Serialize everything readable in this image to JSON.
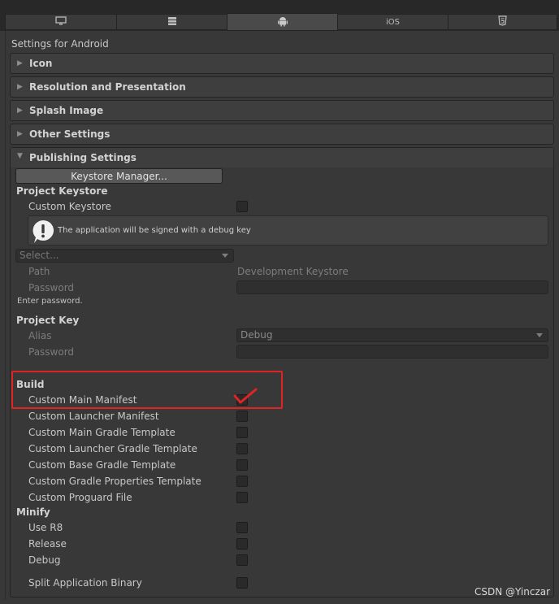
{
  "tabs": [
    {
      "icon": "monitor-icon"
    },
    {
      "icon": "server-icon"
    },
    {
      "icon": "android-icon",
      "active": true
    },
    {
      "label": "iOS"
    },
    {
      "icon": "html5-icon"
    }
  ],
  "header": "Settings for Android",
  "sections": {
    "icon": "Icon",
    "resolution": "Resolution and Presentation",
    "splash": "Splash Image",
    "other": "Other Settings",
    "publishing": "Publishing Settings"
  },
  "keystore_manager_button": "Keystore Manager...",
  "project_keystore": {
    "heading": "Project Keystore",
    "custom_keystore": "Custom Keystore",
    "info_message": "The application will be signed with a debug key",
    "select_value": "Select...",
    "path_label": "Path",
    "path_value": "Development Keystore",
    "password_label": "Password",
    "hint": "Enter password."
  },
  "project_key": {
    "heading": "Project Key",
    "alias_label": "Alias",
    "alias_value": "Debug",
    "password_label": "Password"
  },
  "build": {
    "heading": "Build",
    "items": [
      "Custom Main Manifest",
      "Custom Launcher Manifest",
      "Custom Main Gradle Template",
      "Custom Launcher Gradle Template",
      "Custom Base Gradle Template",
      "Custom Gradle Properties Template",
      "Custom Proguard File"
    ]
  },
  "minify": {
    "heading": "Minify",
    "items": [
      "Use R8",
      "Release",
      "Debug"
    ]
  },
  "split_binary": "Split Application Binary",
  "watermark": "CSDN @Yinczar",
  "colors": {
    "annotation_red": "#e02323",
    "background": "#383838"
  }
}
